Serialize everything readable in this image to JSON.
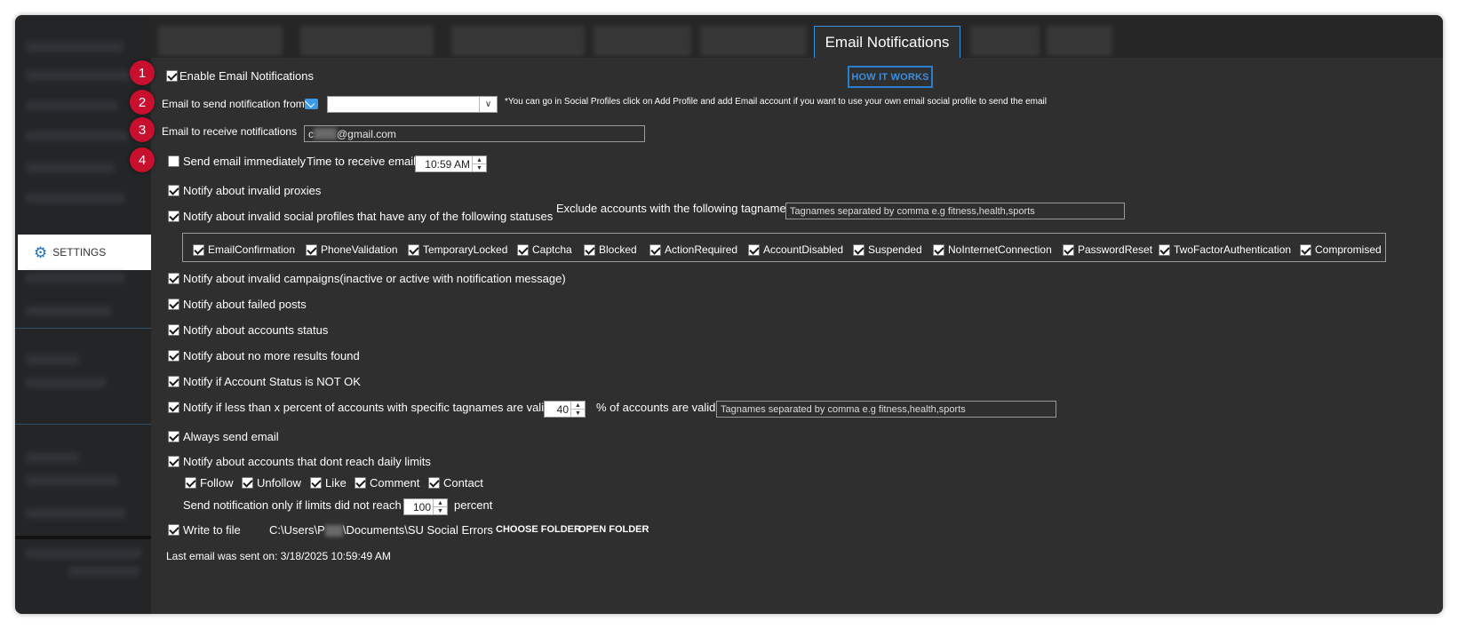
{
  "sidebar": {
    "settings_label": "SETTINGS"
  },
  "tabs": {
    "active_label": "Email Notifications"
  },
  "help_button": "HOW IT WORKS",
  "badges": [
    "1",
    "2",
    "3",
    "4"
  ],
  "enable_email": {
    "label": "Enable Email Notifications",
    "checked": true
  },
  "email_from": {
    "label": "Email to send notification from",
    "value": "",
    "note": "*You can go in Social Profiles click on Add Profile and add Email account if you want to use your own email social profile to send the email"
  },
  "email_to": {
    "label": "Email to receive notifications",
    "prefix": "c",
    "suffix": "@gmail.com"
  },
  "send_immediately": {
    "label": "Send email immediately",
    "checked": false
  },
  "time_to_receive": {
    "label": "Time to receive email",
    "value": "10:59 AM"
  },
  "invalid_proxies": {
    "label": "Notify about invalid proxies",
    "checked": true
  },
  "invalid_profiles": {
    "label": "Notify about invalid social profiles that have any of the following statuses",
    "checked": true
  },
  "exclude_tags": {
    "label": "Exclude accounts with the following tagnames",
    "placeholder": "Tagnames separated by comma e.g fitness,health,sports"
  },
  "statuses": [
    {
      "label": "EmailConfirmation",
      "checked": true
    },
    {
      "label": "PhoneValidation",
      "checked": true
    },
    {
      "label": "TemporaryLocked",
      "checked": true
    },
    {
      "label": "Captcha",
      "checked": true
    },
    {
      "label": "Blocked",
      "checked": true
    },
    {
      "label": "ActionRequired",
      "checked": true
    },
    {
      "label": "AccountDisabled",
      "checked": true
    },
    {
      "label": "Suspended",
      "checked": true
    },
    {
      "label": "NoInternetConnection",
      "checked": true
    },
    {
      "label": "PasswordReset",
      "checked": true
    },
    {
      "label": "TwoFactorAuthentication",
      "checked": true
    },
    {
      "label": "Compromised",
      "checked": true
    }
  ],
  "options": [
    {
      "label": "Notify about invalid campaigns(inactive or active with notification message)",
      "checked": true
    },
    {
      "label": "Notify about failed posts",
      "checked": true
    },
    {
      "label": "Notify about accounts status",
      "checked": true
    },
    {
      "label": "Notify about no more results found",
      "checked": true
    },
    {
      "label": "Notify if Account Status is NOT OK",
      "checked": true
    }
  ],
  "percent_valid": {
    "label": "Notify if less than x percent of accounts with specific tagnames are valid",
    "checked": true,
    "value": "40",
    "suffix": "% of accounts are valid",
    "placeholder": "Tagnames separated by comma e.g fitness,health,sports"
  },
  "always_send": {
    "label": "Always send email",
    "checked": true
  },
  "daily_limits": {
    "label": "Notify about accounts that dont reach daily limits",
    "checked": true
  },
  "limit_actions": [
    {
      "label": "Follow",
      "checked": true
    },
    {
      "label": "Unfollow",
      "checked": true
    },
    {
      "label": "Like",
      "checked": true
    },
    {
      "label": "Comment",
      "checked": true
    },
    {
      "label": "Contact",
      "checked": true
    }
  ],
  "limits_reach": {
    "label": "Send notification only if limits did not reach",
    "value": "100",
    "suffix": "percent"
  },
  "write_to_file": {
    "label": "Write to file",
    "checked": true,
    "path_prefix": "C:\\Users\\P",
    "path_suffix": "\\Documents\\SU Social Errors",
    "choose_label": "CHOOSE FOLDER",
    "open_label": "OPEN FOLDER"
  },
  "last_email": "Last email was sent on: 3/18/2025 10:59:49 AM"
}
